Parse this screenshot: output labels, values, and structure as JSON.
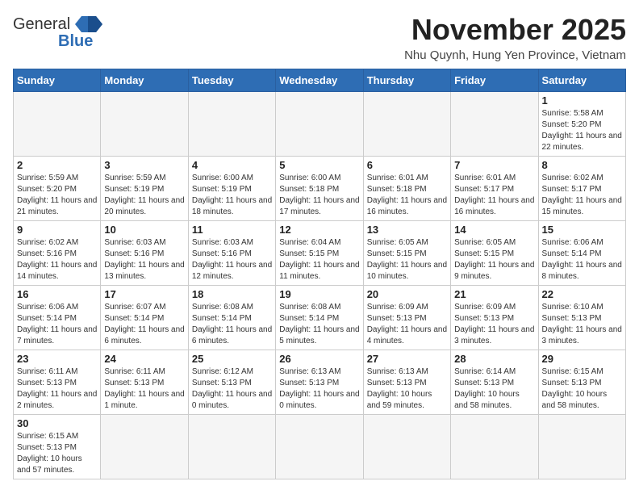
{
  "logo": {
    "general": "General",
    "blue": "Blue"
  },
  "header": {
    "month_year": "November 2025",
    "location": "Nhu Quynh, Hung Yen Province, Vietnam"
  },
  "days_of_week": [
    "Sunday",
    "Monday",
    "Tuesday",
    "Wednesday",
    "Thursday",
    "Friday",
    "Saturday"
  ],
  "weeks": [
    [
      {
        "day": "",
        "info": ""
      },
      {
        "day": "",
        "info": ""
      },
      {
        "day": "",
        "info": ""
      },
      {
        "day": "",
        "info": ""
      },
      {
        "day": "",
        "info": ""
      },
      {
        "day": "",
        "info": ""
      },
      {
        "day": "1",
        "info": "Sunrise: 5:58 AM\nSunset: 5:20 PM\nDaylight: 11 hours and 22 minutes."
      }
    ],
    [
      {
        "day": "2",
        "info": "Sunrise: 5:59 AM\nSunset: 5:20 PM\nDaylight: 11 hours and 21 minutes."
      },
      {
        "day": "3",
        "info": "Sunrise: 5:59 AM\nSunset: 5:19 PM\nDaylight: 11 hours and 20 minutes."
      },
      {
        "day": "4",
        "info": "Sunrise: 6:00 AM\nSunset: 5:19 PM\nDaylight: 11 hours and 18 minutes."
      },
      {
        "day": "5",
        "info": "Sunrise: 6:00 AM\nSunset: 5:18 PM\nDaylight: 11 hours and 17 minutes."
      },
      {
        "day": "6",
        "info": "Sunrise: 6:01 AM\nSunset: 5:18 PM\nDaylight: 11 hours and 16 minutes."
      },
      {
        "day": "7",
        "info": "Sunrise: 6:01 AM\nSunset: 5:17 PM\nDaylight: 11 hours and 16 minutes."
      },
      {
        "day": "8",
        "info": "Sunrise: 6:02 AM\nSunset: 5:17 PM\nDaylight: 11 hours and 15 minutes."
      }
    ],
    [
      {
        "day": "9",
        "info": "Sunrise: 6:02 AM\nSunset: 5:16 PM\nDaylight: 11 hours and 14 minutes."
      },
      {
        "day": "10",
        "info": "Sunrise: 6:03 AM\nSunset: 5:16 PM\nDaylight: 11 hours and 13 minutes."
      },
      {
        "day": "11",
        "info": "Sunrise: 6:03 AM\nSunset: 5:16 PM\nDaylight: 11 hours and 12 minutes."
      },
      {
        "day": "12",
        "info": "Sunrise: 6:04 AM\nSunset: 5:15 PM\nDaylight: 11 hours and 11 minutes."
      },
      {
        "day": "13",
        "info": "Sunrise: 6:05 AM\nSunset: 5:15 PM\nDaylight: 11 hours and 10 minutes."
      },
      {
        "day": "14",
        "info": "Sunrise: 6:05 AM\nSunset: 5:15 PM\nDaylight: 11 hours and 9 minutes."
      },
      {
        "day": "15",
        "info": "Sunrise: 6:06 AM\nSunset: 5:14 PM\nDaylight: 11 hours and 8 minutes."
      }
    ],
    [
      {
        "day": "16",
        "info": "Sunrise: 6:06 AM\nSunset: 5:14 PM\nDaylight: 11 hours and 7 minutes."
      },
      {
        "day": "17",
        "info": "Sunrise: 6:07 AM\nSunset: 5:14 PM\nDaylight: 11 hours and 6 minutes."
      },
      {
        "day": "18",
        "info": "Sunrise: 6:08 AM\nSunset: 5:14 PM\nDaylight: 11 hours and 6 minutes."
      },
      {
        "day": "19",
        "info": "Sunrise: 6:08 AM\nSunset: 5:14 PM\nDaylight: 11 hours and 5 minutes."
      },
      {
        "day": "20",
        "info": "Sunrise: 6:09 AM\nSunset: 5:13 PM\nDaylight: 11 hours and 4 minutes."
      },
      {
        "day": "21",
        "info": "Sunrise: 6:09 AM\nSunset: 5:13 PM\nDaylight: 11 hours and 3 minutes."
      },
      {
        "day": "22",
        "info": "Sunrise: 6:10 AM\nSunset: 5:13 PM\nDaylight: 11 hours and 3 minutes."
      }
    ],
    [
      {
        "day": "23",
        "info": "Sunrise: 6:11 AM\nSunset: 5:13 PM\nDaylight: 11 hours and 2 minutes."
      },
      {
        "day": "24",
        "info": "Sunrise: 6:11 AM\nSunset: 5:13 PM\nDaylight: 11 hours and 1 minute."
      },
      {
        "day": "25",
        "info": "Sunrise: 6:12 AM\nSunset: 5:13 PM\nDaylight: 11 hours and 0 minutes."
      },
      {
        "day": "26",
        "info": "Sunrise: 6:13 AM\nSunset: 5:13 PM\nDaylight: 11 hours and 0 minutes."
      },
      {
        "day": "27",
        "info": "Sunrise: 6:13 AM\nSunset: 5:13 PM\nDaylight: 10 hours and 59 minutes."
      },
      {
        "day": "28",
        "info": "Sunrise: 6:14 AM\nSunset: 5:13 PM\nDaylight: 10 hours and 58 minutes."
      },
      {
        "day": "29",
        "info": "Sunrise: 6:15 AM\nSunset: 5:13 PM\nDaylight: 10 hours and 58 minutes."
      }
    ],
    [
      {
        "day": "30",
        "info": "Sunrise: 6:15 AM\nSunset: 5:13 PM\nDaylight: 10 hours and 57 minutes."
      },
      {
        "day": "",
        "info": ""
      },
      {
        "day": "",
        "info": ""
      },
      {
        "day": "",
        "info": ""
      },
      {
        "day": "",
        "info": ""
      },
      {
        "day": "",
        "info": ""
      },
      {
        "day": "",
        "info": ""
      }
    ]
  ]
}
